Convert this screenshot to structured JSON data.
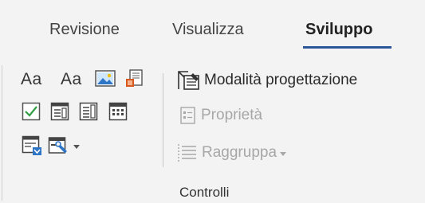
{
  "tabs": [
    {
      "label": "Revisione",
      "active": false
    },
    {
      "label": "Visualizza",
      "active": false
    },
    {
      "label": "Sviluppo",
      "active": true
    }
  ],
  "controls": {
    "rich_text_label": "Aa",
    "plain_text_label": "Aa",
    "icons": {
      "rich_text": "rich-text-content-control-icon",
      "plain_text": "plain-text-content-control-icon",
      "picture": "picture-content-control-icon",
      "building_block": "building-block-gallery-icon",
      "checkbox": "checkbox-content-control-icon",
      "combo_box": "combo-box-content-control-icon",
      "dropdown_list": "dropdown-list-content-control-icon",
      "date_picker": "date-picker-content-control-icon",
      "repeating_section": "repeating-section-content-control-icon",
      "legacy_tools": "legacy-tools-icon"
    }
  },
  "commands": {
    "design_mode": {
      "label": "Modalità progettazione",
      "icon": "design-mode-icon",
      "enabled": true
    },
    "properties": {
      "label": "Proprietà",
      "icon": "properties-icon",
      "enabled": false
    },
    "group": {
      "label": "Raggruppa",
      "icon": "group-icon",
      "enabled": false
    }
  },
  "group_label": "Controlli",
  "colors": {
    "accent_underline": "#2b579a",
    "checkbox_green": "#2f9e44",
    "picture_blue": "#2e75c6",
    "building_orange": "#d65a1f",
    "disabled_text": "#a7a7a7"
  }
}
